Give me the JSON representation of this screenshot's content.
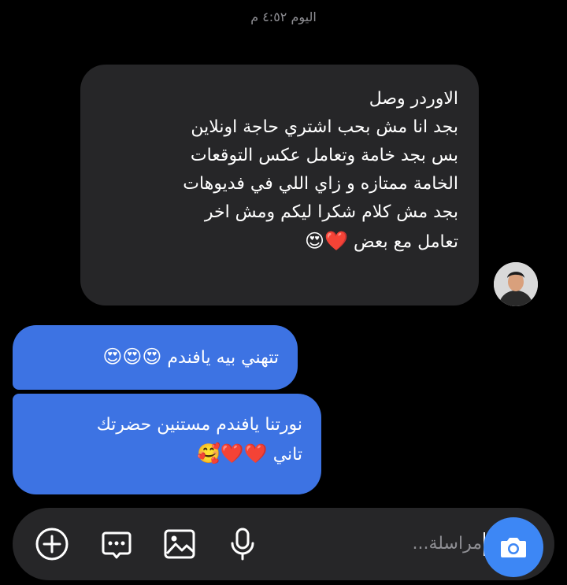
{
  "thread": {
    "timestamp": "اليوم ٤:٥٢ م"
  },
  "messages": {
    "incoming": {
      "lines": [
        "الاوردر وصل",
        "بجد انا مش بحب اشتري حاجة اونلاين",
        "بس بجد خامة وتعامل عكس التوقعات",
        "الخامة ممتازه و زاي اللي في فديوهات",
        "بجد مش كلام شكرا ليكم ومش اخر",
        "تعامل مع بعض"
      ],
      "emoji": "❤️😍"
    },
    "outgoing_1": {
      "text": "تتهني بيه يافندم",
      "emoji": "😍😍😍"
    },
    "outgoing_2": {
      "lines": [
        "نورتنا يافندم مستنين حضرتك",
        "تاني"
      ],
      "emoji": "❤️❤️🥰"
    }
  },
  "composer": {
    "placeholder": "مراسلة...",
    "icons": [
      "add-icon",
      "sticker-chat-icon",
      "gallery-icon",
      "microphone-icon",
      "camera-icon"
    ],
    "accent_color": "#3d87f5"
  },
  "colors": {
    "incoming_bubble": "#262628",
    "outgoing_bubble": "#3d73e3"
  }
}
